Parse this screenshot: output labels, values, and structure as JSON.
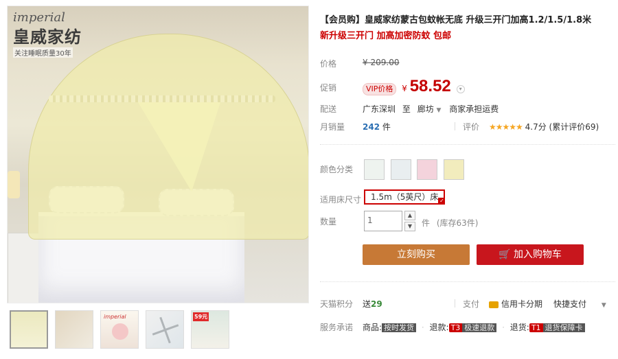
{
  "brand": {
    "script": "imperial",
    "name_cn": "皇威家纺",
    "tagline": "关注睡眠质量30年"
  },
  "gallery": {
    "thumb_badge": "59元",
    "thumb_label": "imperial"
  },
  "product": {
    "title": "【会员购】皇威家纺蒙古包蚊帐无底 升级三开门加高1.2/1.5/1.8米",
    "subtitle": "新升级三开门 加高加密防蚊 包邮"
  },
  "price": {
    "label": "价格",
    "currency": "¥",
    "original": "209.00"
  },
  "promo": {
    "label": "促销",
    "vip_tag": "VIP价格",
    "currency": "¥",
    "price": "58.52",
    "more_icon": "chevron-down-icon"
  },
  "delivery": {
    "label": "配送",
    "from": "广东深圳",
    "to_word": "至",
    "to": "廊坊",
    "fee": "商家承担运费"
  },
  "sales": {
    "label": "月销量",
    "count": "242",
    "unit": "件",
    "rating_label": "评价",
    "stars": "★★★★★",
    "score": "4.7分",
    "review_text": "(累计评价69)"
  },
  "options": {
    "color_label": "颜色分类",
    "size_label": "适用床尺寸",
    "size_selected": "1.5m（5英尺）床",
    "qty_label": "数量",
    "qty_value": "1",
    "qty_unit": "件",
    "stock": "(库存63件)"
  },
  "actions": {
    "buy_now": "立刻购买",
    "add_cart": "加入购物车"
  },
  "footer": {
    "points_label": "天猫积分",
    "points_prefix": "送",
    "points_value": "29",
    "pay_label": "支付",
    "pay_card": "信用卡分期",
    "pay_fast": "快捷支付",
    "service_label": "服务承诺",
    "svc1_prefix": "商品:",
    "svc1_tag": "按时发货",
    "svc2_prefix": "退款:",
    "svc2_tag_red": "T3",
    "svc2_tag": "极速退款",
    "svc3_prefix": "退货:",
    "svc3_tag_red": "T1",
    "svc3_tag": "退货保障卡"
  },
  "colors": {
    "price_red": "#c40000",
    "buy_button": "#c77936",
    "cart_button": "#c8161d",
    "link_blue": "#2b6fb3"
  }
}
